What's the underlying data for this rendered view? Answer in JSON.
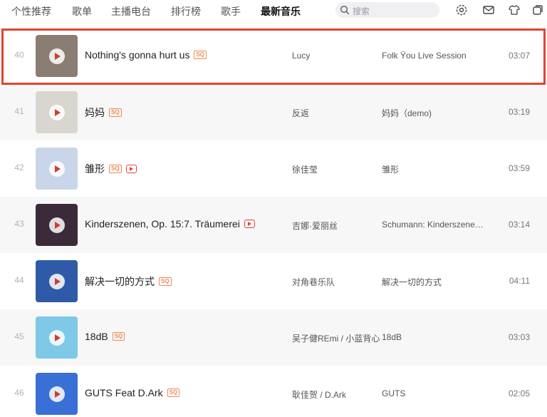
{
  "nav": {
    "tabs": [
      {
        "label": "个性推荐",
        "active": false
      },
      {
        "label": "歌单",
        "active": false
      },
      {
        "label": "主播电台",
        "active": false
      },
      {
        "label": "排行榜",
        "active": false
      },
      {
        "label": "歌手",
        "active": false
      },
      {
        "label": "最新音乐",
        "active": true
      }
    ]
  },
  "search": {
    "placeholder": "搜索",
    "icon": "search-icon"
  },
  "tools": [
    "gear-icon",
    "mail-icon",
    "shirt-icon",
    "mini-window-icon"
  ],
  "songs": [
    {
      "index": "40",
      "title": "Nothing's gonna hurt us",
      "sq": "SQ",
      "mv": false,
      "artist": "Lucy",
      "album": "Folk Ÿou Live Session",
      "duration": "03:07",
      "cover_color": "#8a7e72"
    },
    {
      "index": "41",
      "title": "妈妈",
      "sq": "SQ",
      "mv": false,
      "artist": "反返",
      "album": "妈妈（demo)",
      "duration": "03:19",
      "cover_color": "#d9d6cf"
    },
    {
      "index": "42",
      "title": "雏形",
      "sq": "SQ",
      "mv": true,
      "artist": "徐佳莹",
      "album": "雏形",
      "duration": "03:59",
      "cover_color": "#c9d6ea"
    },
    {
      "index": "43",
      "title": "Kinderszenen, Op. 15:7. Träumerei",
      "sq": "",
      "mv": true,
      "artist": "吉娜·爱丽丝",
      "album": "Schumann: Kinderszene…",
      "duration": "03:14",
      "cover_color": "#3b2a3a"
    },
    {
      "index": "44",
      "title": "解决一切的方式",
      "sq": "SQ",
      "mv": false,
      "artist": "对角巷乐队",
      "album": "解决一切的方式",
      "duration": "04:11",
      "cover_color": "#2f5aa8"
    },
    {
      "index": "45",
      "title": "18dB",
      "sq": "SQ",
      "mv": false,
      "artist": "吴子健REmi / 小蓝背心",
      "album": "18dB",
      "duration": "03:03",
      "cover_color": "#7ec8e8"
    },
    {
      "index": "46",
      "title": "GUTS Feat D.Ark",
      "sq": "SQ",
      "mv": false,
      "artist": "耿佳贺 / D.Ark",
      "album": "GUTS",
      "duration": "02:05",
      "cover_color": "#3a6fd8"
    }
  ],
  "colors": {
    "highlight": "#e0452f",
    "sq_badge": "#f08a53",
    "play": "#d33a31"
  }
}
